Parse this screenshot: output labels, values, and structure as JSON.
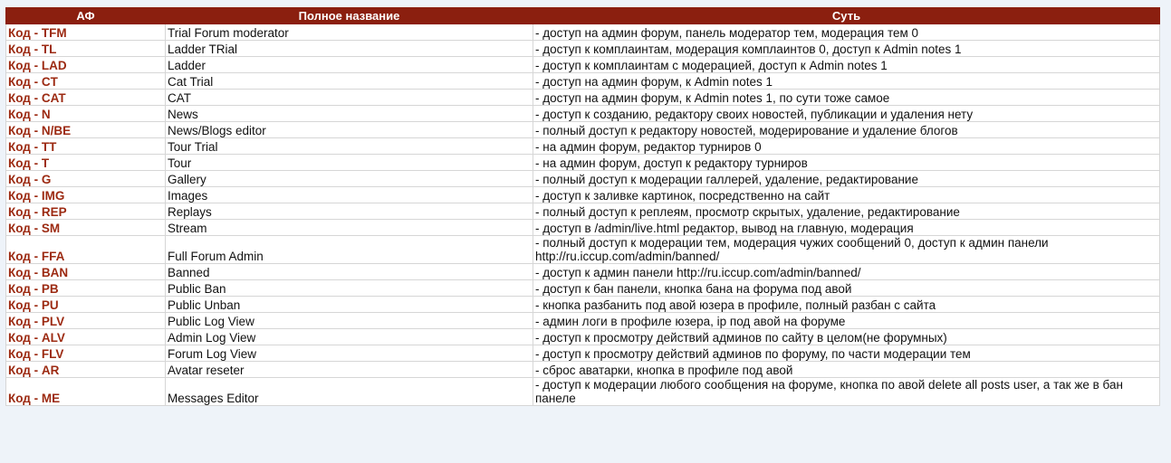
{
  "colors": {
    "header_bg": "#8b1f0f",
    "header_text": "#ffffff",
    "code_text": "#9c2a12",
    "page_bg": "#eef3f9"
  },
  "table": {
    "headers": [
      "АФ",
      "Полное название",
      "Суть"
    ],
    "rows": [
      {
        "code": "Код - TFM",
        "name": "Trial Forum moderator",
        "desc": "- доступ на админ форум, панель модератор тем, модерация тем 0"
      },
      {
        "code": "Код - TL",
        "name": "Ladder TRial",
        "desc": "- доступ к комплаинтам, модерация комплаинтов 0, доступ к Admin notes 1"
      },
      {
        "code": "Код - LAD",
        "name": "Ladder",
        "desc": "- доступ к комплаинтам с модерацией, доступ к Admin notes 1"
      },
      {
        "code": "Код - CT",
        "name": "Cat Trial",
        "desc": "- доступ на админ форум, к Admin notes 1"
      },
      {
        "code": "Код - CAT",
        "name": "CAT",
        "desc": "- доступ на админ форум, к Admin notes 1, по сути тоже самое"
      },
      {
        "code": "Код - N",
        "name": "News",
        "desc": "- доступ к созданию, редактору своих новостей, публикации и удаления нету"
      },
      {
        "code": "Код - N/BE",
        "name": "News/Blogs editor",
        "desc": "- полный доступ к редактору новостей, модерирование и удаление блогов"
      },
      {
        "code": "Код - TT",
        "name": "Tour Trial",
        "desc": "- на админ форум, редактор турниров 0"
      },
      {
        "code": "Код - T",
        "name": "Tour",
        "desc": "- на админ форум, доступ к редактору турниров"
      },
      {
        "code": "Код - G",
        "name": "Gallery",
        "desc": "- полный доступ к модерации галлерей, удаление, редактирование"
      },
      {
        "code": "Код - IMG",
        "name": "Images",
        "desc": "- доступ к заливке картинок, посредственно на сайт"
      },
      {
        "code": "Код - REP",
        "name": "Replays",
        "desc": "- полный доступ к реплеям, просмотр скрытых, удаление, редактирование"
      },
      {
        "code": "Код - SM",
        "name": "Stream",
        "desc": "- доступ в /admin/live.html редактор, вывод на главную, модерация"
      },
      {
        "code": "Код - FFA",
        "name": "Full Forum Admin",
        "desc": "- полный доступ к модерации тем, модерация чужих сообщений 0, доступ к админ панели http://ru.iccup.com/admin/banned/",
        "wrap": true
      },
      {
        "code": "Код - BAN",
        "name": "Banned",
        "desc": "- доступ к админ панели http://ru.iccup.com/admin/banned/"
      },
      {
        "code": "Код - PB",
        "name": "Public Ban",
        "desc": "- доступ к бан панели, кнопка бана на форума под авой"
      },
      {
        "code": "Код - PU",
        "name": "Public Unban",
        "desc": "- кнопка разбанить под авой юзера в профиле, полный разбан с сайта"
      },
      {
        "code": "Код - PLV",
        "name": "Public Log View",
        "desc": "- админ логи в профиле юзера, ip под авой на форуме"
      },
      {
        "code": "Код - ALV",
        "name": "Admin Log View",
        "desc": "- доступ к просмотру действий админов по сайту в целом(не форумных)"
      },
      {
        "code": "Код - FLV",
        "name": "Forum Log View",
        "desc": "- доступ к просмотру действий админов по форуму, по части модерации тем"
      },
      {
        "code": "Код - AR",
        "name": "Avatar reseter",
        "desc": "- сброс аватарки, кнопка в профиле под авой"
      },
      {
        "code": "Код - ME",
        "name": "Messages Editor",
        "desc": "- доступ к модерации любого сообщения на форуме, кнопка по авой delete all posts user, а так же в бан панеле",
        "wrap": true
      }
    ]
  }
}
